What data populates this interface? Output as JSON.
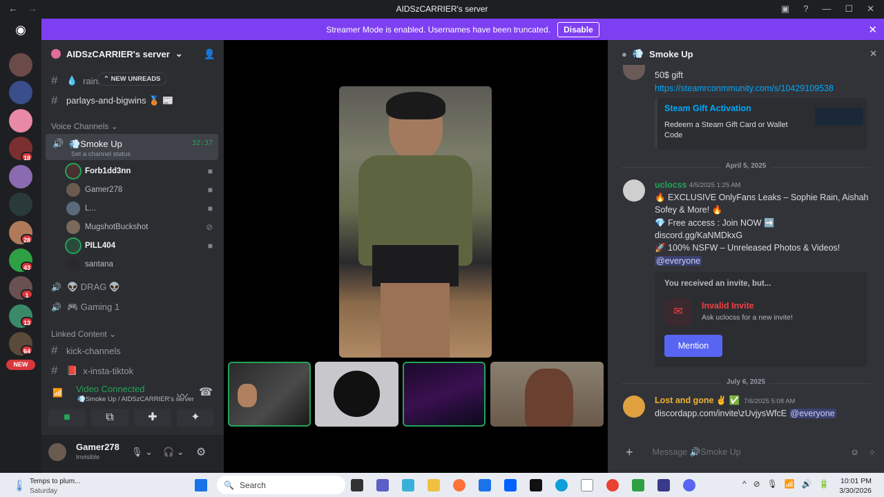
{
  "window": {
    "title": "AIDSzCARRIER's server",
    "back": "←",
    "forward": "→"
  },
  "banner": {
    "text": "Streamer Mode is enabled. Usernames have been truncated.",
    "button": "Disable",
    "close": "✕"
  },
  "guilds": {
    "badges": [
      "18",
      "28",
      "43",
      "1",
      "13",
      "64"
    ],
    "new_label": "NEW"
  },
  "server": {
    "name": "AIDSzCARRIER's server",
    "chevron": "⌄"
  },
  "channels": {
    "new_unreads": "NEW UNREADS",
    "text1": "rainb",
    "text2": "parlays-and-bigwins 🥉 📰",
    "voice_category": "Voice Channels",
    "active_voice": "Smoke Up",
    "active_timer": "32:37",
    "status_placeholder": "Set a channel status",
    "voice_users": [
      "Forb1dd3nn",
      "Gamer278",
      "L...",
      "MugshotBuckshot",
      "PILL404",
      "santana"
    ],
    "drag": "👽 DRAG 👽",
    "gaming": "🎮 Gaming 1",
    "linked_category": "Linked Content",
    "linked1": "kick-channels",
    "linked2": "x-insta-tiktok"
  },
  "rtc": {
    "status": "Video Connected",
    "channel": "Smoke Up / AIDSzCARRIER's server"
  },
  "user": {
    "name": "Gamer278",
    "status": "Invisible"
  },
  "chat": {
    "channel": "Smoke Up",
    "msg0": {
      "text": "50$ gift",
      "link": "https://steamrconmmunity.com/s/10429109538",
      "embed_title": "Steam Gift Activation",
      "embed_desc": "Redeem a Steam Gift Card or Wallet Code"
    },
    "date1": "April 5, 2025",
    "msg1": {
      "author": "uclocss",
      "time": "4/5/2025 1:25 AM",
      "line1": "🔥 EXCLUSIVE OnlyFans Leaks – Sophie Rain, Aishah Sofey & More! 🔥",
      "line2": "💎 Free access : Join NOW ➡️",
      "line3": "discord.gg/KaNMDkxG",
      "line4": "🚀 100% NSFW – Unreleased Photos & Videos!",
      "mention": "@everyone"
    },
    "invite": {
      "header": "You received an invite, but...",
      "title": "Invalid Invite",
      "desc": "Ask uclocss for a new invite!",
      "button": "Mention"
    },
    "date2": "July 6, 2025",
    "msg2": {
      "author": "Lost and gone ✌️ ✅",
      "time": "7/6/2025 5:08 AM",
      "text": "discordapp.com/invite\\zUvjysWfcE",
      "mention": "@everyone"
    },
    "composer_placeholder": "Message 🔊Smoke Up"
  },
  "taskbar": {
    "weather": "Temps to plum...",
    "day": "Saturday",
    "search": "Search",
    "time": "10:01 PM",
    "date": "3/30/2026"
  },
  "colors": {
    "accent": "#7e3ff2",
    "blurple": "#5865f2",
    "green": "#23a559",
    "red": "#da373c"
  }
}
